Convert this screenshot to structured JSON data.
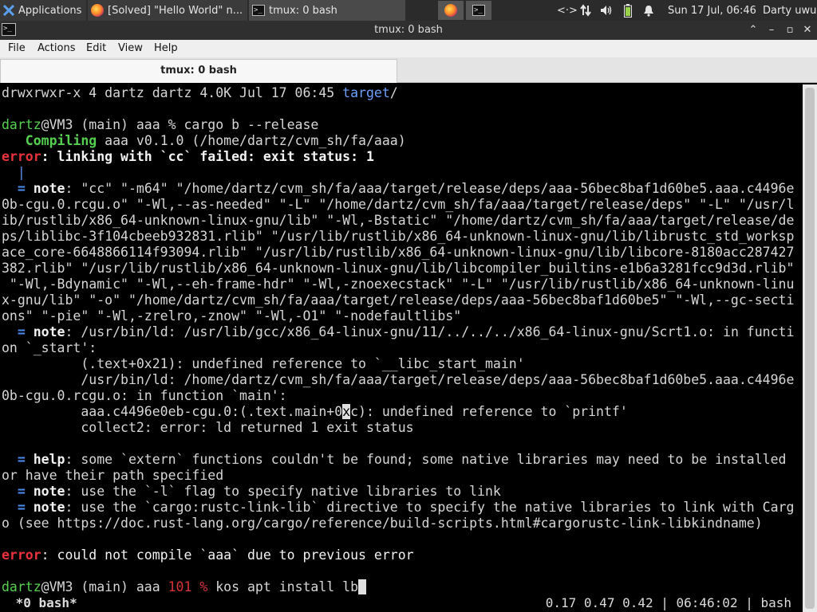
{
  "panel": {
    "applications": "Applications",
    "task1": "[Solved] \"Hello World\" n...",
    "task2": "tmux: 0 bash",
    "clock": "Sun 17 Jul, 06:46",
    "user": "Darty uwu"
  },
  "window": {
    "title": "tmux: 0 bash",
    "menu": [
      "File",
      "Actions",
      "Edit",
      "View",
      "Help"
    ],
    "tab": "tmux: 0 bash"
  },
  "terminal": {
    "listing": "drwxrwxr-x 4 dartz dartz 4.0K Jul 17 06:45 ",
    "listing_dir": "target",
    "listing_slash": "/",
    "prompt_user": "dartz",
    "prompt_host": "@VM3 (main) aaa % ",
    "cmd1": "cargo b --release",
    "compiling_word": "   Compiling",
    "compiling_rest": " aaa v0.1.0 (/home/dartz/cvm_sh/fa/aaa)",
    "error_word": "error",
    "link_error_msg": ": linking with `cc` failed: exit status: 1",
    "pipe_line": "  |",
    "eq": "  = ",
    "note_word": "note",
    "help_word": "help",
    "note1_lines": [
      ": \"cc\" \"-m64\" \"/home/dartz/cvm_sh/fa/aaa/target/release/deps/aaa-56bec8baf1d60be5.aaa.c4496e",
      "0b-cgu.0.rcgu.o\" \"-Wl,--as-needed\" \"-L\" \"/home/dartz/cvm_sh/fa/aaa/target/release/deps\" \"-L\" \"/usr/l",
      "ib/rustlib/x86_64-unknown-linux-gnu/lib\" \"-Wl,-Bstatic\" \"/home/dartz/cvm_sh/fa/aaa/target/release/de",
      "ps/liblibc-3f104cbeeb932831.rlib\" \"/usr/lib/rustlib/x86_64-unknown-linux-gnu/lib/librustc_std_worksp",
      "ace_core-6648866114f93094.rlib\" \"/usr/lib/rustlib/x86_64-unknown-linux-gnu/lib/libcore-8180acc287427",
      "382.rlib\" \"/usr/lib/rustlib/x86_64-unknown-linux-gnu/lib/libcompiler_builtins-e1b6a3281fcc9d3d.rlib\"",
      " \"-Wl,-Bdynamic\" \"-Wl,--eh-frame-hdr\" \"-Wl,-znoexecstack\" \"-L\" \"/usr/lib/rustlib/x86_64-unknown-linu",
      "x-gnu/lib\" \"-o\" \"/home/dartz/cvm_sh/fa/aaa/target/release/deps/aaa-56bec8baf1d60be5\" \"-Wl,--gc-secti",
      "ons\" \"-pie\" \"-Wl,-zrelro,-znow\" \"-Wl,-O1\" \"-nodefaultlibs\""
    ],
    "note2_first": ": /usr/bin/ld: /usr/lib/gcc/x86_64-linux-gnu/11/../../../x86_64-linux-gnu/Scrt1.o: in functi",
    "note2_lines": [
      "on `_start':",
      "          (.text+0x21): undefined reference to `__libc_start_main'",
      "          /usr/bin/ld: /home/dartz/cvm_sh/fa/aaa/target/release/deps/aaa-56bec8baf1d60be5.aaa.c4496e",
      "0b-cgu.0.rcgu.o: in function `main':"
    ],
    "printf_pre": "          aaa.c4496e0eb-cgu.0:(.text.main+0",
    "printf_cur": "x",
    "printf_post": "c): undefined reference to `printf'",
    "collect2": "          collect2: error: ld returned 1 exit status",
    "help_msg": ": some `extern` functions couldn't be found; some native libraries may need to be installed",
    "help_cont": "or have their path specified",
    "note3_msg": ": use the `-l` flag to specify native libraries to link",
    "note4_msg": ": use the `cargo:rustc-link-lib` directive to specify the native libraries to link with Carg",
    "note4_cont": "o (see https://doc.rust-lang.org/cargo/reference/build-scripts.html#cargorustc-link-libkindname)",
    "final_error_msg": ": could not compile `aaa` due to previous error",
    "prompt2_host": "@VM3 (main) aaa ",
    "exit_code": "101 %",
    "cmd2": " kos apt install lb"
  },
  "tmux_status": {
    "left": " *0 bash*",
    "right": "0.17 0.47 0.42 | 06:46:02 | bash"
  }
}
